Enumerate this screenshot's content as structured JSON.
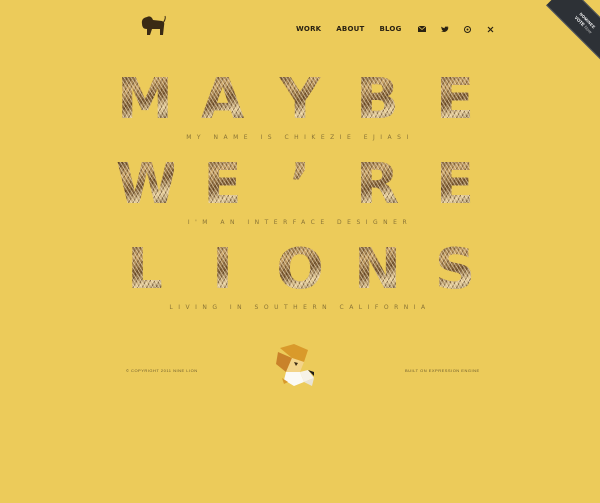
{
  "nav": {
    "work": "WORK",
    "about": "ABOUT",
    "blog": "BLOG",
    "icons": [
      "mail-icon",
      "twitter-icon",
      "dribbble-icon",
      "close-icon"
    ]
  },
  "ribbon": {
    "nominee": "NOMINEE",
    "vote": "VOTE",
    "vote_suffix": "Now"
  },
  "hero": {
    "line1": [
      "M",
      "A",
      "Y",
      "B",
      "E"
    ],
    "line2": [
      "W",
      "E",
      "’",
      "R",
      "E"
    ],
    "line3": [
      "L",
      "I",
      "O",
      "N",
      "S"
    ],
    "tagline1": "MY NAME IS CHIKEZIE EJIASI",
    "tagline2": "I'M AN INTERFACE DESIGNER",
    "tagline3": "LIVING IN SOUTHERN CALIFORNIA"
  },
  "footer": {
    "copyright": "© COPYRIGHT 2011 NINE LION",
    "built": "BUILT ON EXPRESSION ENGINE"
  },
  "colors": {
    "background": "#eccb5a",
    "text_dark": "#2a2212",
    "tagline": "#8a7436"
  }
}
